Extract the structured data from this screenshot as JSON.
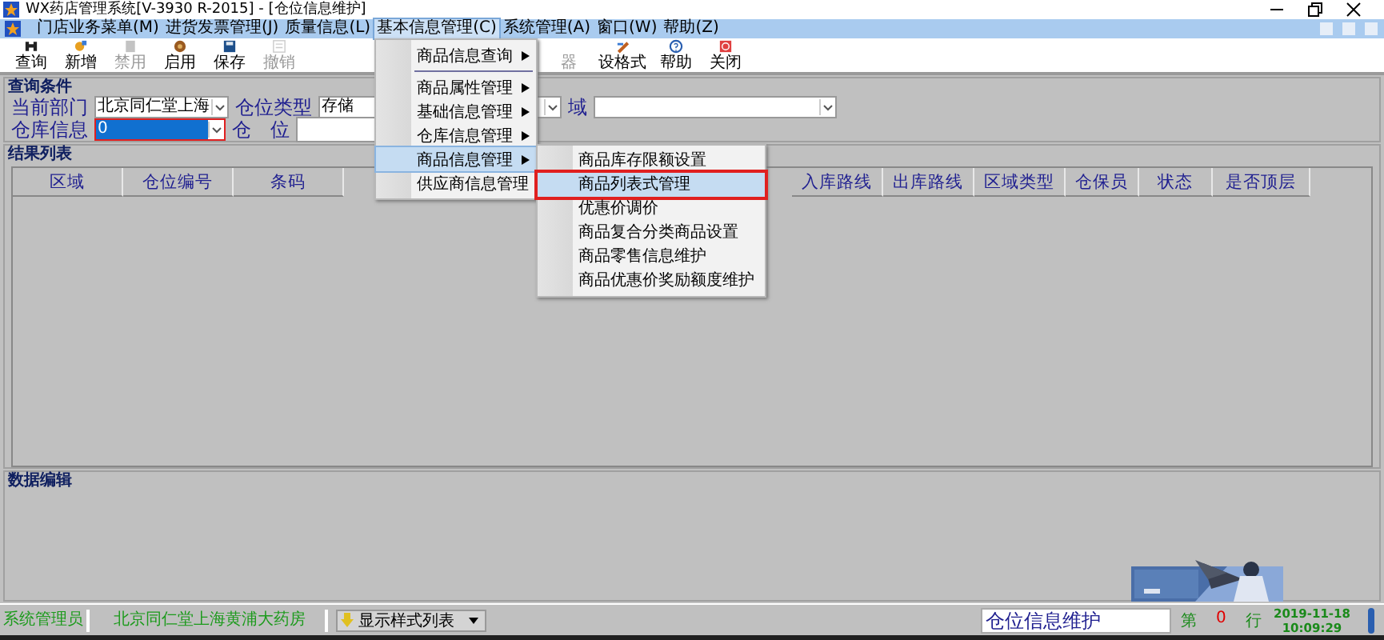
{
  "window": {
    "title": "WX药店管理系统[V-3930 R-2015] - [仓位信息维护]"
  },
  "menubar": [
    {
      "label": "门店业务菜单(M)",
      "selected": false
    },
    {
      "label": "进货发票管理(J)",
      "selected": false
    },
    {
      "label": "质量信息(L)",
      "selected": false
    },
    {
      "label": "基本信息管理(C)",
      "selected": true
    },
    {
      "label": "系统管理(A)",
      "selected": false
    },
    {
      "label": "窗口(W)",
      "selected": false
    },
    {
      "label": "帮助(Z)",
      "selected": false
    }
  ],
  "menu_dropdown": [
    {
      "kind": "item",
      "label": "商品信息查询",
      "selected": false
    },
    {
      "kind": "separator"
    },
    {
      "kind": "item",
      "label": "商品属性管理",
      "selected": false
    },
    {
      "kind": "item",
      "label": "基础信息管理",
      "selected": false
    },
    {
      "kind": "item",
      "label": "仓库信息管理",
      "selected": false
    },
    {
      "kind": "item",
      "label": "商品信息管理",
      "selected": true
    },
    {
      "kind": "item",
      "label": "供应商信息管理",
      "selected": false
    }
  ],
  "submenu": [
    {
      "label": "商品库存限额设置",
      "selected": false
    },
    {
      "label": "商品列表式管理",
      "selected": true
    },
    {
      "label": "优惠价调价",
      "selected": false
    },
    {
      "label": "商品复合分类商品设置",
      "selected": false
    },
    {
      "label": "商品零售信息维护",
      "selected": false
    },
    {
      "label": "商品优惠价奖励额度维护",
      "selected": false
    }
  ],
  "toolbar": [
    {
      "label": "查询",
      "disabled": false
    },
    {
      "label": "新增",
      "disabled": false
    },
    {
      "label": "禁用",
      "disabled": true
    },
    {
      "label": "启用",
      "disabled": false
    },
    {
      "label": "保存",
      "disabled": false
    },
    {
      "label": "撤销",
      "disabled": true
    },
    {
      "label": "器",
      "disabled": true
    },
    {
      "label": "设格式",
      "disabled": false
    },
    {
      "label": "帮助",
      "disabled": false
    },
    {
      "label": "关闭",
      "disabled": false
    }
  ],
  "query": {
    "title": "查询条件",
    "row_1": [
      {
        "label": "当前部门",
        "value": "北京同仁堂上海",
        "selected": false
      },
      {
        "label": "仓位类型",
        "value": "存储",
        "selected": false
      },
      {
        "label": "域",
        "selected": false
      }
    ],
    "row_2": [
      {
        "label": "仓库信息",
        "value": "0",
        "selected": true
      },
      {
        "label": "仓　位"
      }
    ]
  },
  "results": {
    "title": "结果列表",
    "columns": [
      "区域",
      "仓位编号",
      "条码",
      "入库路线",
      "出库路线",
      "区域类型",
      "仓保员",
      "状态",
      "是否顶层"
    ]
  },
  "data_edit": {
    "title": "数据编辑"
  },
  "status_bar": {
    "user": "系统管理员",
    "store": "北京同仁堂上海黄浦大药房",
    "style_selector": "显示样式列表",
    "form_name": "仓位信息维护",
    "row_prefix": "第",
    "row_count": "0",
    "row_suffix": "行",
    "date": "2019-11-18",
    "time": "10:09:29"
  }
}
